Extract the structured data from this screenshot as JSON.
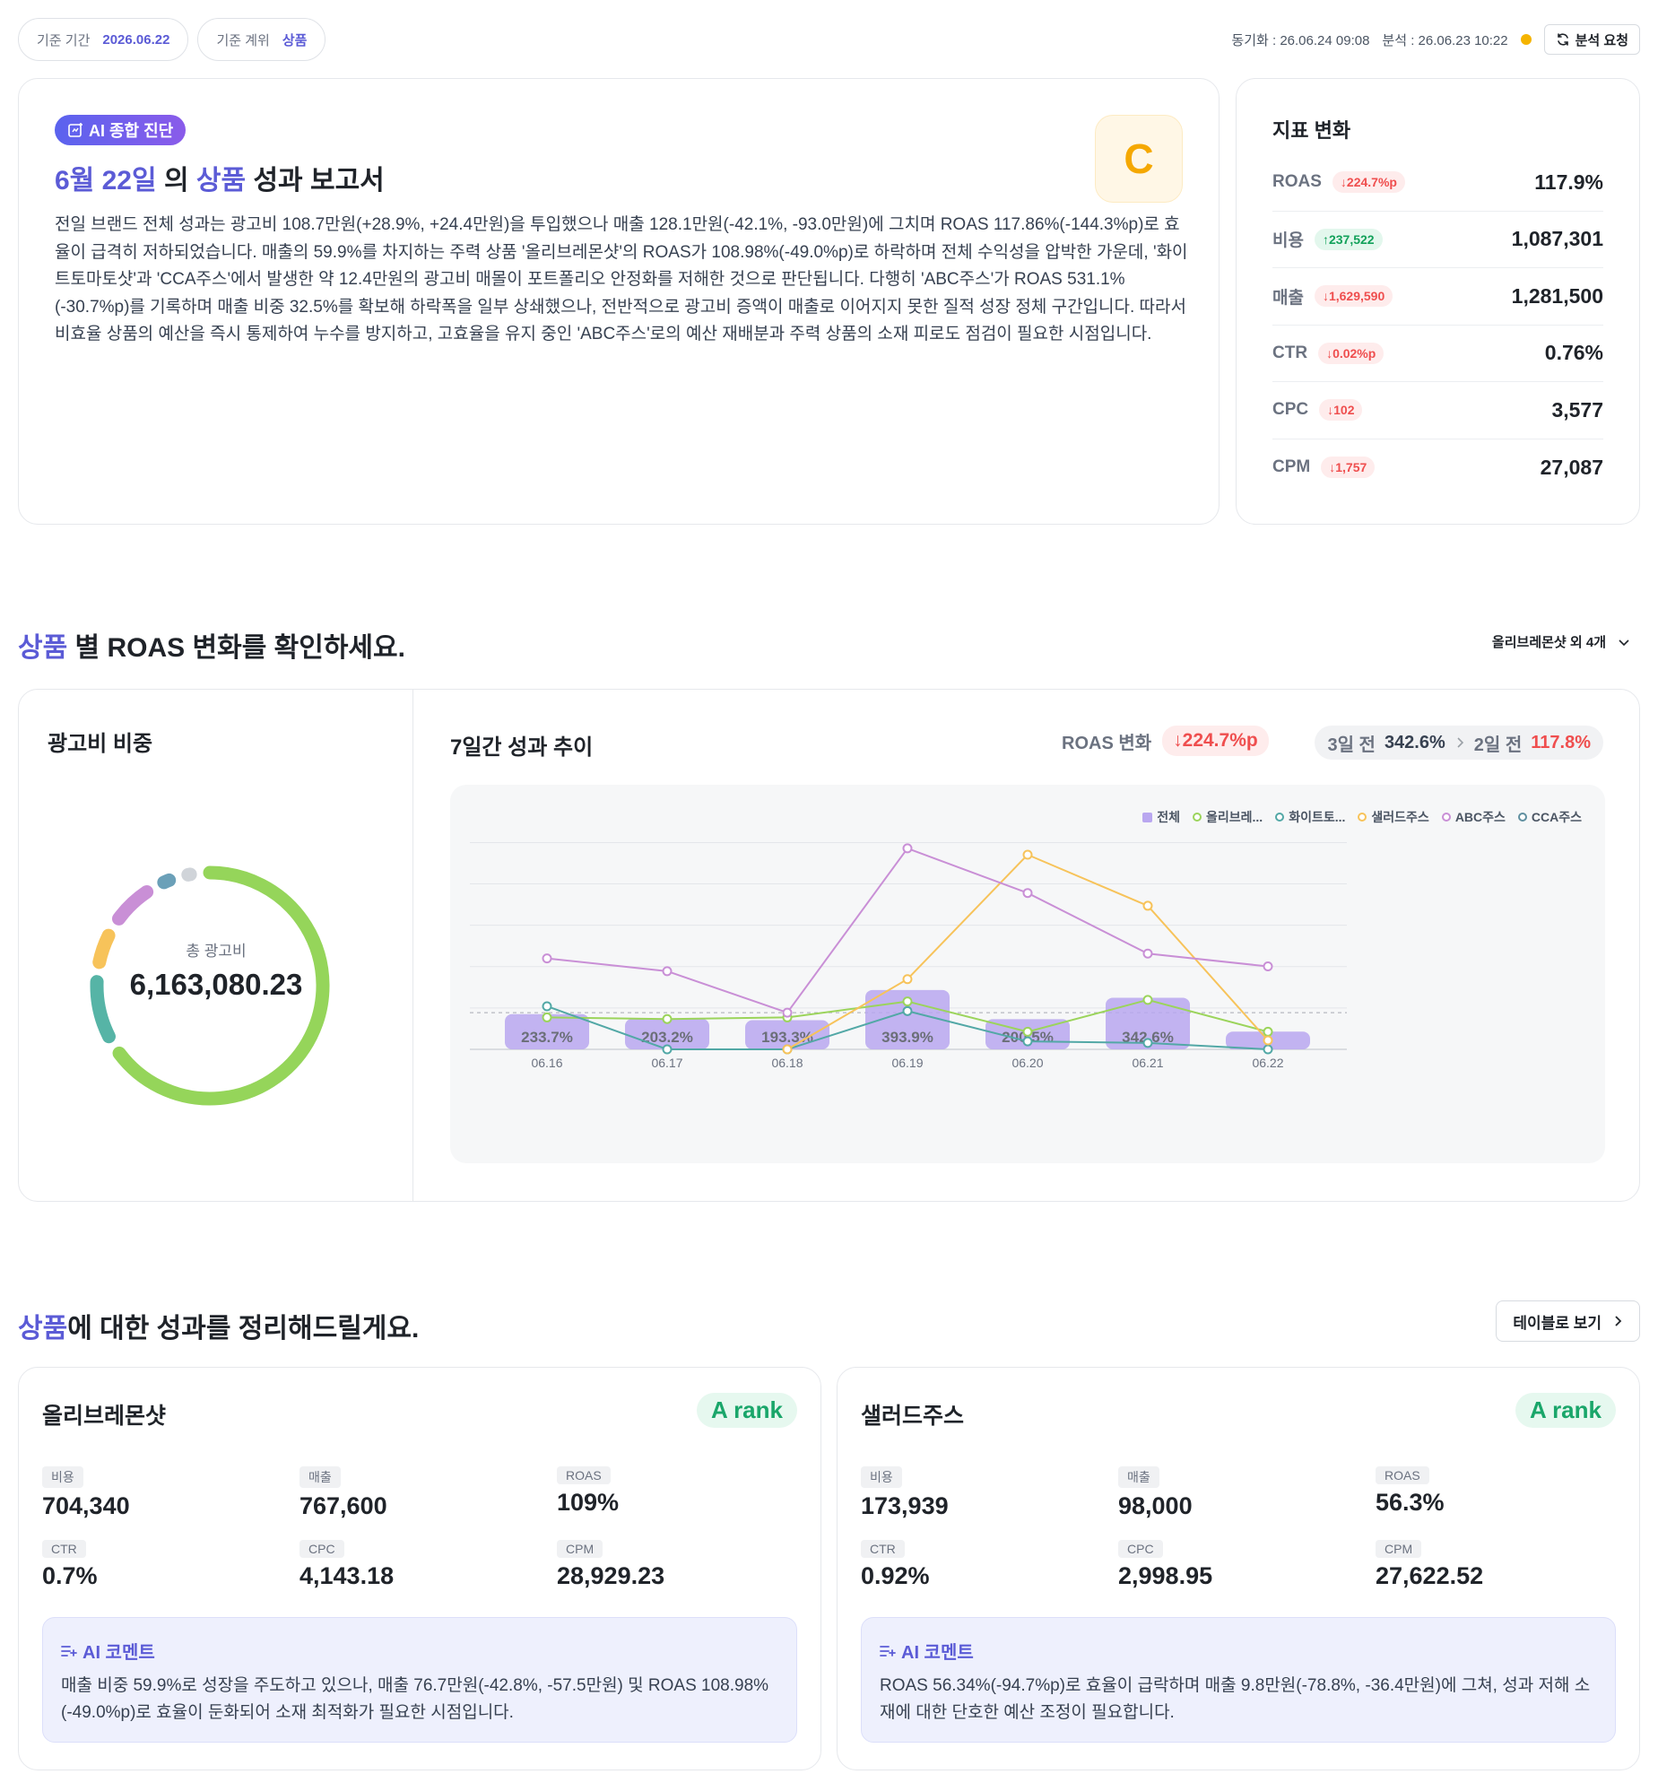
{
  "topbar": {
    "period_label": "기준 기간",
    "period_value": "2026.06.22",
    "tier_label": "기준 계위",
    "tier_value": "상품",
    "sync_text": "동기화 : 26.06.24 09:08",
    "analysis_text": "분석 : 26.06.23 10:22",
    "status_color": "#f5b400",
    "request_button": "분석 요청"
  },
  "report": {
    "badge": "AI 종합 진단",
    "title_date": "6월 22일",
    "title_mid": "의",
    "title_tier": "상품",
    "title_tail": "성과 보고서",
    "grade": "C",
    "body": "전일 브랜드 전체 성과는 광고비 108.7만원(+28.9%, +24.4만원)을 투입했으나 매출 128.1만원(-42.1%, -93.0만원)에 그치며 ROAS 117.86%(-144.3%p)로 효율이 급격히 저하되었습니다. 매출의 59.9%를 차지하는 주력 상품 '올리브레몬샷'의 ROAS가 108.98%(-49.0%p)로 하락하며 전체 수익성을 압박한 가운데, '화이트토마토샷'과 'CCA주스'에서 발생한 약 12.4만원의 광고비 매몰이 포트폴리오 안정화를 저해한 것으로 판단됩니다. 다행히 'ABC주스'가 ROAS 531.1%(-30.7%p)를 기록하며 매출 비중 32.5%를 확보해 하락폭을 일부 상쇄했으나, 전반적으로 광고비 증액이 매출로 이어지지 못한 질적 성장 정체 구간입니다. 따라서 비효율 상품의 예산을 즉시 통제하여 누수를 방지하고, 고효율을 유지 중인 'ABC주스'로의 예산 재배분과 주력 상품의 소재 피로도 점검이 필요한 시점입니다."
  },
  "metrics": {
    "title": "지표 변화",
    "rows": [
      {
        "label": "ROAS",
        "delta": "↓224.7%p",
        "value": "117.9%"
      },
      {
        "label": "비용",
        "delta": "↑237,522",
        "value": "1,087,301"
      },
      {
        "label": "매출",
        "delta": "↓1,629,590",
        "value": "1,281,500"
      },
      {
        "label": "CTR",
        "delta": "↓0.02%p",
        "value": "0.76%"
      },
      {
        "label": "CPC",
        "delta": "↓102",
        "value": "3,577"
      },
      {
        "label": "CPM",
        "delta": "↓1,757",
        "value": "27,087"
      }
    ]
  },
  "section1": {
    "tier": "상품",
    "title": "별 ROAS 변화를 확인하세요.",
    "dropdown": "올리브레몬샷 외 4개"
  },
  "spend": {
    "title": "광고비 비중",
    "center_label": "총 광고비",
    "center_value": "6,163,080.23"
  },
  "trend": {
    "title": "7일간 성과 추이",
    "roas_change_label": "ROAS 변화",
    "roas_change_value": "↓224.7%p",
    "compare_a_label": "3일 전",
    "compare_a_value": "342.6%",
    "compare_b_label": "2일 전",
    "compare_b_value": "117.8%"
  },
  "chart_data": {
    "type": "bar",
    "categories": [
      "06.16",
      "06.17",
      "06.18",
      "06.19",
      "06.20",
      "06.21",
      "06.22"
    ],
    "bar_series": {
      "name": "전체",
      "values": [
        233.7,
        203.2,
        193.3,
        393.9,
        200.5,
        342.6,
        117.8
      ],
      "labels": [
        "233.7%",
        "203.2%",
        "193.3%",
        "393.9%",
        "200.5%",
        "342.6%",
        ""
      ],
      "color": "#b9a7f0"
    },
    "series": [
      {
        "name": "전체",
        "type": "bar",
        "values": [
          233.7,
          203.2,
          193.3,
          393.9,
          200.5,
          342.6,
          117.8
        ],
        "color": "#b9a7f0"
      },
      {
        "name": "올리브레...",
        "type": "line",
        "values": [
          200,
          190,
          200,
          300,
          110,
          310,
          110
        ],
        "color": "#9bd45b"
      },
      {
        "name": "화이트토...",
        "type": "line",
        "values": [
          270,
          0,
          0,
          240,
          50,
          40,
          0
        ],
        "color": "#52a8a6"
      },
      {
        "name": "샐러드주스",
        "type": "line",
        "values": [
          null,
          null,
          0,
          440,
          1220,
          900,
          56.3
        ],
        "color": "#f7c35a"
      },
      {
        "name": "ABC주스",
        "type": "line",
        "values": [
          570,
          490,
          230,
          1260,
          980,
          600,
          520
        ],
        "color": "#c98fd6"
      },
      {
        "name": "CCA주스",
        "type": "line",
        "values": [
          null,
          null,
          null,
          null,
          null,
          null,
          null
        ],
        "color": "#5f8fa0"
      }
    ],
    "ylim": [
      0,
      1400
    ],
    "reference_line": 230,
    "grid": true,
    "legend": "top-right"
  },
  "donut_data": {
    "type": "pie",
    "values": [
      65.0,
      8.0,
      4.0,
      5.5,
      0.8,
      0.3
    ],
    "colors": [
      "#95d55a",
      "#56b4a6",
      "#f7c35a",
      "#c98fd6",
      "#6ba0b8",
      "#d0d4d9"
    ]
  },
  "section2": {
    "tier": "상품",
    "title": "에 대한 성과를 정리해드릴게요.",
    "table_button": "테이블로 보기"
  },
  "products": [
    {
      "name": "올리브레몬샷",
      "rank": "A rank",
      "kpis": [
        {
          "label": "비용",
          "value": "704,340"
        },
        {
          "label": "매출",
          "value": "767,600"
        },
        {
          "label": "ROAS",
          "value": "109%"
        },
        {
          "label": "CTR",
          "value": "0.7%"
        },
        {
          "label": "CPC",
          "value": "4,143.18"
        },
        {
          "label": "CPM",
          "value": "28,929.23"
        }
      ],
      "ai_label": "AI 코멘트",
      "ai_text": "매출 비중 59.9%로 성장을 주도하고 있으나, 매출 76.7만원(-42.8%, -57.5만원) 및 ROAS 108.98%(-49.0%p)로 효율이 둔화되어 소재 최적화가 필요한 시점입니다."
    },
    {
      "name": "샐러드주스",
      "rank": "A rank",
      "kpis": [
        {
          "label": "비용",
          "value": "173,939"
        },
        {
          "label": "매출",
          "value": "98,000"
        },
        {
          "label": "ROAS",
          "value": "56.3%"
        },
        {
          "label": "CTR",
          "value": "0.92%"
        },
        {
          "label": "CPC",
          "value": "2,998.95"
        },
        {
          "label": "CPM",
          "value": "27,622.52"
        }
      ],
      "ai_label": "AI 코멘트",
      "ai_text": "ROAS 56.34%(-94.7%p)로 효율이 급락하며 매출 9.8만원(-78.8%, -36.4만원)에 그쳐, 성과 저해 소재에 대한 단호한 예산 조정이 필요합니다."
    }
  ]
}
